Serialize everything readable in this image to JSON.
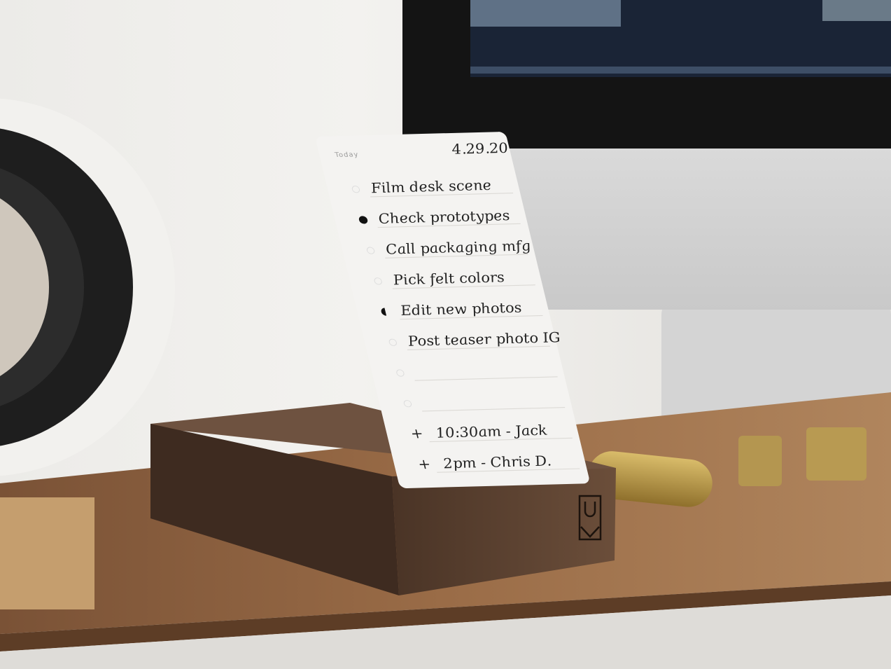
{
  "card": {
    "header_label": "Today",
    "date": "4.29.20",
    "tasks": [
      {
        "text": "Film desk scene",
        "marker": "empty"
      },
      {
        "text": "Check prototypes",
        "marker": "filled"
      },
      {
        "text": "Call packaging mfg",
        "marker": "empty"
      },
      {
        "text": "Pick felt colors",
        "marker": "empty"
      },
      {
        "text": "Edit new photos",
        "marker": "half"
      },
      {
        "text": "Post teaser photo IG",
        "marker": "empty"
      },
      {
        "text": "",
        "marker": "empty"
      },
      {
        "text": "",
        "marker": "empty"
      }
    ],
    "appointments": [
      {
        "marker": "+",
        "text": "10:30am - Jack"
      },
      {
        "marker": "+",
        "text": "2pm - Chris D."
      }
    ]
  },
  "holder": {
    "logo": "U"
  },
  "colors": {
    "wood": "#5a4030",
    "shelf": "#8a5e3c",
    "brass": "#b8963e",
    "card": "#f4f3f1"
  }
}
